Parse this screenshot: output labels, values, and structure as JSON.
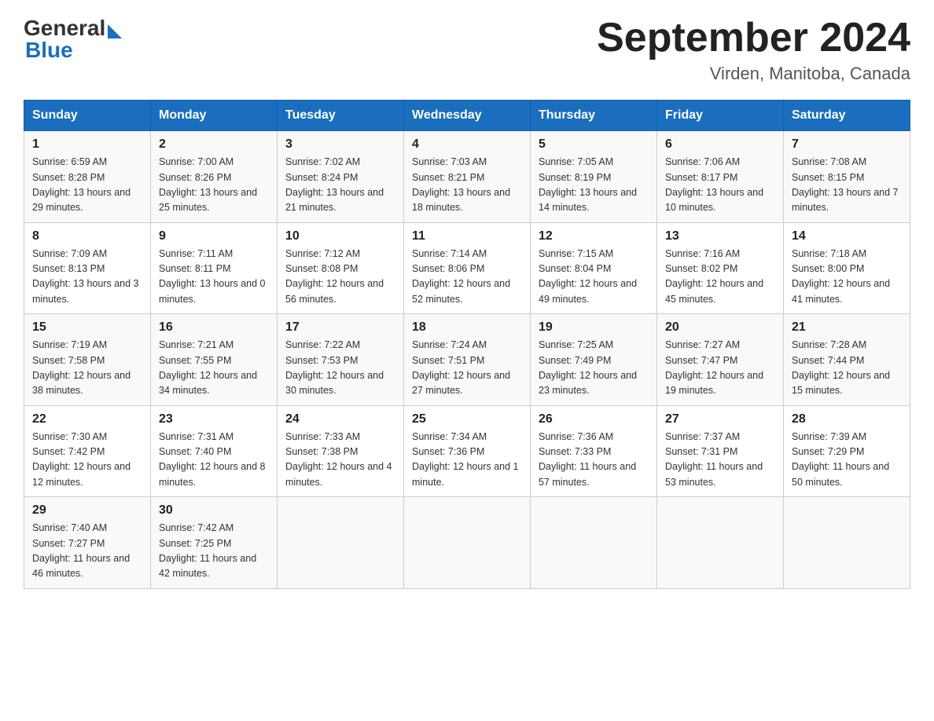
{
  "header": {
    "logo_general": "General",
    "logo_blue": "Blue",
    "month_title": "September 2024",
    "location": "Virden, Manitoba, Canada"
  },
  "days_of_week": [
    "Sunday",
    "Monday",
    "Tuesday",
    "Wednesday",
    "Thursday",
    "Friday",
    "Saturday"
  ],
  "weeks": [
    [
      {
        "day": "1",
        "sunrise": "Sunrise: 6:59 AM",
        "sunset": "Sunset: 8:28 PM",
        "daylight": "Daylight: 13 hours and 29 minutes."
      },
      {
        "day": "2",
        "sunrise": "Sunrise: 7:00 AM",
        "sunset": "Sunset: 8:26 PM",
        "daylight": "Daylight: 13 hours and 25 minutes."
      },
      {
        "day": "3",
        "sunrise": "Sunrise: 7:02 AM",
        "sunset": "Sunset: 8:24 PM",
        "daylight": "Daylight: 13 hours and 21 minutes."
      },
      {
        "day": "4",
        "sunrise": "Sunrise: 7:03 AM",
        "sunset": "Sunset: 8:21 PM",
        "daylight": "Daylight: 13 hours and 18 minutes."
      },
      {
        "day": "5",
        "sunrise": "Sunrise: 7:05 AM",
        "sunset": "Sunset: 8:19 PM",
        "daylight": "Daylight: 13 hours and 14 minutes."
      },
      {
        "day": "6",
        "sunrise": "Sunrise: 7:06 AM",
        "sunset": "Sunset: 8:17 PM",
        "daylight": "Daylight: 13 hours and 10 minutes."
      },
      {
        "day": "7",
        "sunrise": "Sunrise: 7:08 AM",
        "sunset": "Sunset: 8:15 PM",
        "daylight": "Daylight: 13 hours and 7 minutes."
      }
    ],
    [
      {
        "day": "8",
        "sunrise": "Sunrise: 7:09 AM",
        "sunset": "Sunset: 8:13 PM",
        "daylight": "Daylight: 13 hours and 3 minutes."
      },
      {
        "day": "9",
        "sunrise": "Sunrise: 7:11 AM",
        "sunset": "Sunset: 8:11 PM",
        "daylight": "Daylight: 13 hours and 0 minutes."
      },
      {
        "day": "10",
        "sunrise": "Sunrise: 7:12 AM",
        "sunset": "Sunset: 8:08 PM",
        "daylight": "Daylight: 12 hours and 56 minutes."
      },
      {
        "day": "11",
        "sunrise": "Sunrise: 7:14 AM",
        "sunset": "Sunset: 8:06 PM",
        "daylight": "Daylight: 12 hours and 52 minutes."
      },
      {
        "day": "12",
        "sunrise": "Sunrise: 7:15 AM",
        "sunset": "Sunset: 8:04 PM",
        "daylight": "Daylight: 12 hours and 49 minutes."
      },
      {
        "day": "13",
        "sunrise": "Sunrise: 7:16 AM",
        "sunset": "Sunset: 8:02 PM",
        "daylight": "Daylight: 12 hours and 45 minutes."
      },
      {
        "day": "14",
        "sunrise": "Sunrise: 7:18 AM",
        "sunset": "Sunset: 8:00 PM",
        "daylight": "Daylight: 12 hours and 41 minutes."
      }
    ],
    [
      {
        "day": "15",
        "sunrise": "Sunrise: 7:19 AM",
        "sunset": "Sunset: 7:58 PM",
        "daylight": "Daylight: 12 hours and 38 minutes."
      },
      {
        "day": "16",
        "sunrise": "Sunrise: 7:21 AM",
        "sunset": "Sunset: 7:55 PM",
        "daylight": "Daylight: 12 hours and 34 minutes."
      },
      {
        "day": "17",
        "sunrise": "Sunrise: 7:22 AM",
        "sunset": "Sunset: 7:53 PM",
        "daylight": "Daylight: 12 hours and 30 minutes."
      },
      {
        "day": "18",
        "sunrise": "Sunrise: 7:24 AM",
        "sunset": "Sunset: 7:51 PM",
        "daylight": "Daylight: 12 hours and 27 minutes."
      },
      {
        "day": "19",
        "sunrise": "Sunrise: 7:25 AM",
        "sunset": "Sunset: 7:49 PM",
        "daylight": "Daylight: 12 hours and 23 minutes."
      },
      {
        "day": "20",
        "sunrise": "Sunrise: 7:27 AM",
        "sunset": "Sunset: 7:47 PM",
        "daylight": "Daylight: 12 hours and 19 minutes."
      },
      {
        "day": "21",
        "sunrise": "Sunrise: 7:28 AM",
        "sunset": "Sunset: 7:44 PM",
        "daylight": "Daylight: 12 hours and 15 minutes."
      }
    ],
    [
      {
        "day": "22",
        "sunrise": "Sunrise: 7:30 AM",
        "sunset": "Sunset: 7:42 PM",
        "daylight": "Daylight: 12 hours and 12 minutes."
      },
      {
        "day": "23",
        "sunrise": "Sunrise: 7:31 AM",
        "sunset": "Sunset: 7:40 PM",
        "daylight": "Daylight: 12 hours and 8 minutes."
      },
      {
        "day": "24",
        "sunrise": "Sunrise: 7:33 AM",
        "sunset": "Sunset: 7:38 PM",
        "daylight": "Daylight: 12 hours and 4 minutes."
      },
      {
        "day": "25",
        "sunrise": "Sunrise: 7:34 AM",
        "sunset": "Sunset: 7:36 PM",
        "daylight": "Daylight: 12 hours and 1 minute."
      },
      {
        "day": "26",
        "sunrise": "Sunrise: 7:36 AM",
        "sunset": "Sunset: 7:33 PM",
        "daylight": "Daylight: 11 hours and 57 minutes."
      },
      {
        "day": "27",
        "sunrise": "Sunrise: 7:37 AM",
        "sunset": "Sunset: 7:31 PM",
        "daylight": "Daylight: 11 hours and 53 minutes."
      },
      {
        "day": "28",
        "sunrise": "Sunrise: 7:39 AM",
        "sunset": "Sunset: 7:29 PM",
        "daylight": "Daylight: 11 hours and 50 minutes."
      }
    ],
    [
      {
        "day": "29",
        "sunrise": "Sunrise: 7:40 AM",
        "sunset": "Sunset: 7:27 PM",
        "daylight": "Daylight: 11 hours and 46 minutes."
      },
      {
        "day": "30",
        "sunrise": "Sunrise: 7:42 AM",
        "sunset": "Sunset: 7:25 PM",
        "daylight": "Daylight: 11 hours and 42 minutes."
      },
      null,
      null,
      null,
      null,
      null
    ]
  ]
}
